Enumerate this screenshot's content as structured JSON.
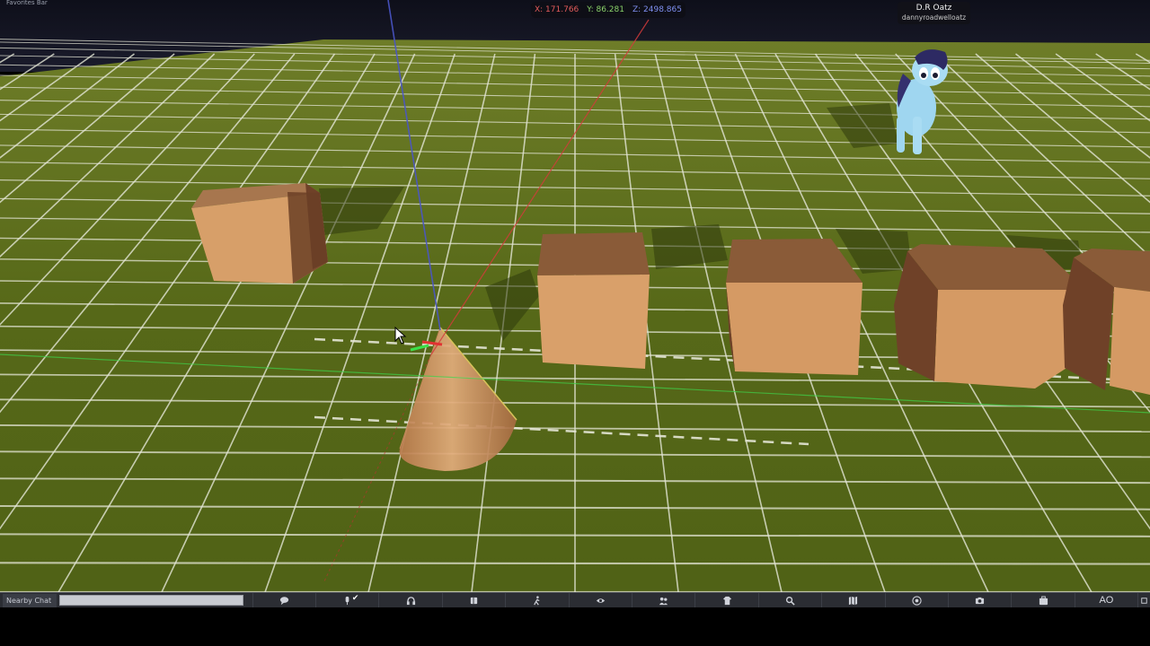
{
  "window": {
    "favorites_bar_label": "Favorites Bar"
  },
  "coords": {
    "x": "X: 171.766",
    "y": "Y: 86.281",
    "z": "Z: 2498.865"
  },
  "avatar": {
    "display_name": "D.R Oatz",
    "username": "dannyroadwelloatz"
  },
  "chat": {
    "label": "Nearby Chat",
    "input_value": ""
  },
  "toolbar": {
    "buttons": [
      {
        "name": "chat-button",
        "icon": "speech-bubble-icon"
      },
      {
        "name": "voice-button",
        "icon": "microphone-icon"
      },
      {
        "name": "speak-button",
        "icon": "headset-icon"
      },
      {
        "name": "build-button",
        "icon": "build-cube-icon"
      },
      {
        "name": "move-button",
        "icon": "walking-person-icon"
      },
      {
        "name": "view-button",
        "icon": "eye-icon"
      },
      {
        "name": "people-button",
        "icon": "people-icon"
      },
      {
        "name": "appearance-button",
        "icon": "shirt-icon"
      },
      {
        "name": "search-button",
        "icon": "search-icon"
      },
      {
        "name": "map-button",
        "icon": "map-icon"
      },
      {
        "name": "minimap-button",
        "icon": "radar-icon"
      },
      {
        "name": "snapshot-button",
        "icon": "camera-icon"
      },
      {
        "name": "inventory-button",
        "icon": "briefcase-icon"
      }
    ],
    "ao_label": "AO"
  },
  "colors": {
    "sky": "#12131f",
    "ground": "#5c6b1f",
    "grid_line": "#e4e6d6",
    "wood_light": "#d9a06a",
    "wood_dark": "#7a4a2e",
    "coord_x": "#e25b5b",
    "coord_y": "#8ad16a",
    "coord_z": "#7f8ff0",
    "toolbar_bg": "#2b2d33"
  }
}
